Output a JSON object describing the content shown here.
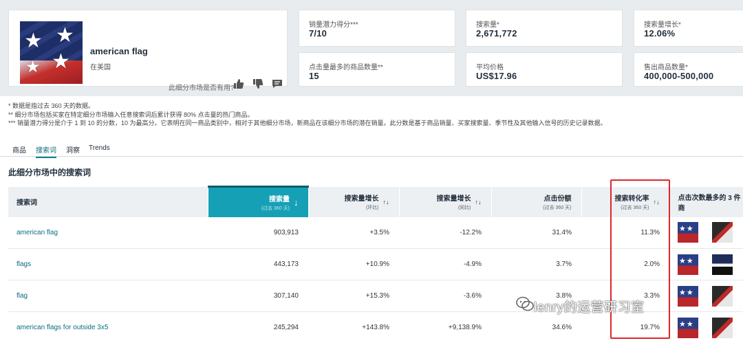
{
  "product": {
    "title": "american flag",
    "subtitle": "在美国",
    "helpful_question": "此细分市场是否有用?"
  },
  "metrics": [
    {
      "label": "销量潜力得分***",
      "value": "7/10"
    },
    {
      "label": "搜索量*",
      "value": "2,671,772"
    },
    {
      "label": "搜索量增长*",
      "value": "12.06%"
    },
    {
      "label": "点击量最多的商品数量**",
      "value": "15"
    },
    {
      "label": "平均价格",
      "value": "US$17.96"
    },
    {
      "label": "售出商品数量*",
      "value": "400,000-500,000"
    }
  ],
  "notes": [
    "* 数据是指过去 360 天的数据。",
    "** 细分市场包括买家在特定细分市场输入任意搜索词后累计获得 80% 点击量的热门商品。",
    "*** 销量潜力得分是介于 1 到 10 的分数，10 为最高分。它表明在同一商品类别中，相对于其他细分市场，新商品在该细分市场的潜在销量。此分数是基于商品销量、买家搜索量、季节性及其他输入信号的历史记录数据。"
  ],
  "tabs": [
    {
      "label": "商品",
      "active": false
    },
    {
      "label": "搜索词",
      "active": true
    },
    {
      "label": "洞察",
      "active": false
    },
    {
      "label": "Trends",
      "active": false
    }
  ],
  "section_title": "此细分市场中的搜索词",
  "table": {
    "headers": [
      {
        "main": "搜索词",
        "sub": ""
      },
      {
        "main": "搜索量",
        "sub": "(过去 360 天)"
      },
      {
        "main": "搜索量增长",
        "sub": "(环比)"
      },
      {
        "main": "搜索量增长",
        "sub": "(同比)"
      },
      {
        "main": "点击份额",
        "sub": "(过去 360 天)"
      },
      {
        "main": "搜索转化率",
        "sub": "(过去 360 天)"
      },
      {
        "main": "点击次数最多的 3 件商",
        "sub": ""
      }
    ],
    "rows": [
      {
        "keyword": "american flag",
        "volume": "903,913",
        "growth_mom": "+3.5%",
        "growth_yoy": "-12.2%",
        "click_share": "31.4%",
        "conversion": "11.3%",
        "thumbs": [
          "usa",
          "dark"
        ]
      },
      {
        "keyword": "flags",
        "volume": "443,173",
        "growth_mom": "+10.9%",
        "growth_yoy": "-4.9%",
        "click_share": "3.7%",
        "conversion": "2.0%",
        "thumbs": [
          "usa",
          "trump"
        ]
      },
      {
        "keyword": "flag",
        "volume": "307,140",
        "growth_mom": "+15.3%",
        "growth_yoy": "-3.6%",
        "click_share": "3.8%",
        "conversion": "3.3%",
        "thumbs": [
          "usa",
          "dark"
        ]
      },
      {
        "keyword": "american flags for outside 3x5",
        "volume": "245,294",
        "growth_mom": "+143.8%",
        "growth_yoy": "+9,138.9%",
        "click_share": "34.6%",
        "conversion": "19.7%",
        "thumbs": [
          "usa",
          "dark"
        ]
      }
    ]
  },
  "watermark": "lenry的运营研习室",
  "colors": {
    "accent": "#16a0b5",
    "highlight": "#e0242a",
    "link": "#0a6d7d"
  }
}
